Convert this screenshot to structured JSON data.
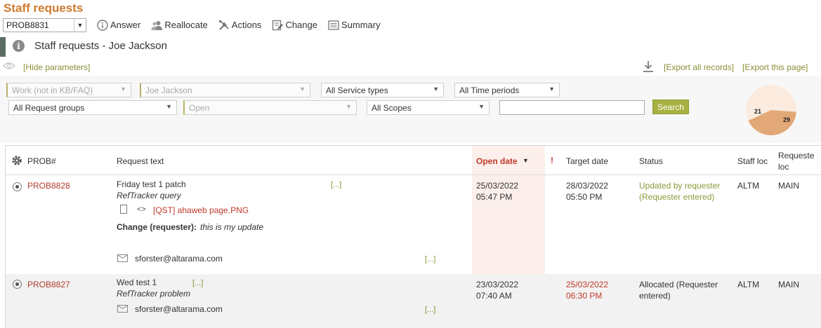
{
  "page": {
    "title": "Staff requests"
  },
  "toolbar": {
    "prob_value": "PROB8831",
    "answer": "Answer",
    "reallocate": "Reallocate",
    "actions": "Actions",
    "change": "Change",
    "summary": "Summary"
  },
  "subheader": {
    "info_glyph": "i",
    "title": "Staff requests - Joe Jackson"
  },
  "params": {
    "hide": "[Hide parameters]",
    "export_all": "[Export all records]",
    "export_page": "[Export this page]"
  },
  "filters": {
    "work": "Work (not in KB/FAQ)",
    "staff": "Joe Jackson",
    "service": "All Service types",
    "period": "All Time periods",
    "group": "All Request groups",
    "state": "Open",
    "scope": "All Scopes",
    "search_value": "",
    "search_label": "Search"
  },
  "pie": {
    "slices": [
      {
        "value": 21,
        "color": "#e3a878"
      },
      {
        "value": 29,
        "color": "#fbebdf"
      }
    ],
    "label_a": "21",
    "label_b": "29"
  },
  "table": {
    "headers": {
      "prob": "PROB#",
      "text": "Request text",
      "open": "Open date",
      "flag": "!",
      "target": "Target date",
      "status": "Status",
      "staff_loc": "Staff loc",
      "req_loc_1": "Requeste",
      "req_loc_2": "loc"
    },
    "rows": [
      {
        "prob": "PROB8828",
        "title": "Friday test 1 patch",
        "more1": "[...]",
        "subtitle": "RefTracker query",
        "attachment": "[QST] ahaweb page.PNG",
        "change_label": "Change (requester):",
        "change_text": "this is my update",
        "email": "sforster@altarama.com",
        "more2": "[...]",
        "open_date": "25/03/2022",
        "open_time": "05:47 PM",
        "target_date": "28/03/2022",
        "target_time": "05:50 PM",
        "status1": "Updated by requester",
        "status2": "(Requester entered)",
        "staff_loc": "ALTM",
        "req_loc": "MAIN"
      },
      {
        "prob": "PROB8827",
        "title": "Wed test 1",
        "more1": "[...]",
        "subtitle": "RefTracker problem",
        "email": "sforster@altarama.com",
        "more2": "[...]",
        "open_date": "23/03/2022",
        "open_time": "07:40 AM",
        "target_date": "25/03/2022",
        "target_time": "06:30 PM",
        "status1": "Allocated (Requester",
        "status2": "entered)",
        "staff_loc": "ALTM",
        "req_loc": "MAIN"
      }
    ]
  }
}
